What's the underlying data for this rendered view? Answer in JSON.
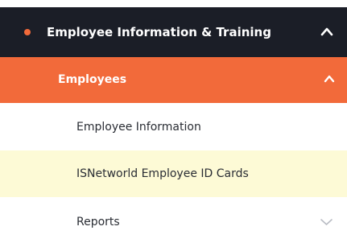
{
  "menu": {
    "section": {
      "label": "Employee Information & Training",
      "icon": "chevron-up-icon",
      "bullet_color": "#f26a3a"
    },
    "group": {
      "label": "Employees",
      "icon": "chevron-up-icon",
      "background_color": "#f26a3a"
    },
    "items": [
      {
        "label": "Employee Information"
      },
      {
        "label": "ISNetworld Employee ID Cards",
        "highlighted": true
      },
      {
        "label": "Reports",
        "icon": "chevron-down-icon"
      }
    ]
  }
}
